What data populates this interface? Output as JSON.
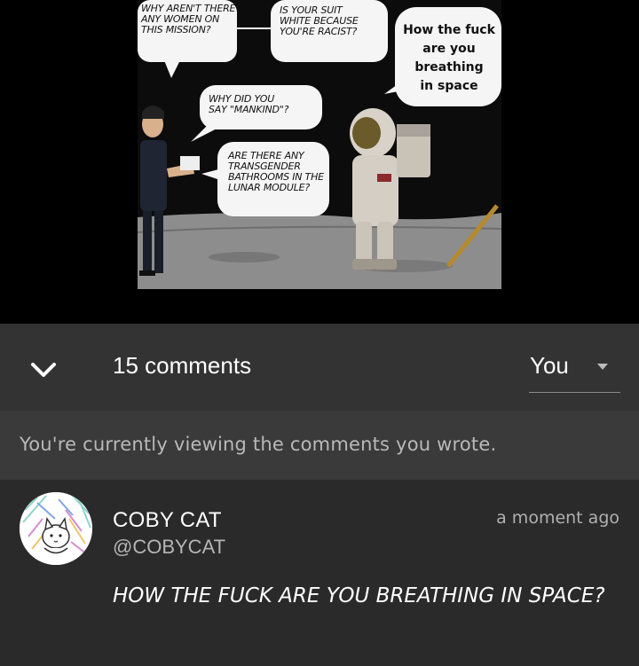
{
  "post": {
    "image": {
      "caption_bubbles": [
        "WHY AREN'T THERE\nANY WOMEN ON\nTHIS MISSION?",
        "IS YOUR SUIT\nWHITE BECAUSE\nYOU'RE RACIST?",
        "WHY DID YOU\nSAY \"MANKIND\"?",
        "ARE THERE ANY\nTRANSGENDER\nBATHROOMS IN THE\nLUNAR MODULE?"
      ],
      "added_caption": "How the fuck\nare you\nbreathing\nin space"
    }
  },
  "comments_header": {
    "count_label": "15 comments",
    "filter_value": "You",
    "collapse_icon": "chevron-down-icon",
    "filter_icon": "caret-down-icon"
  },
  "info_banner": {
    "text": "You're currently viewing the comments you wrote."
  },
  "comment": {
    "user_name": "COBY CAT",
    "handle": "@COBYCAT",
    "timestamp": "a moment ago",
    "text": "HOW THE FUCK ARE YOU BREATHING IN SPACE?"
  },
  "colors": {
    "background": "#2a2a2a",
    "header_bg": "#333333",
    "banner_bg": "#3a3a3a",
    "muted_text": "#b0b0b0"
  }
}
